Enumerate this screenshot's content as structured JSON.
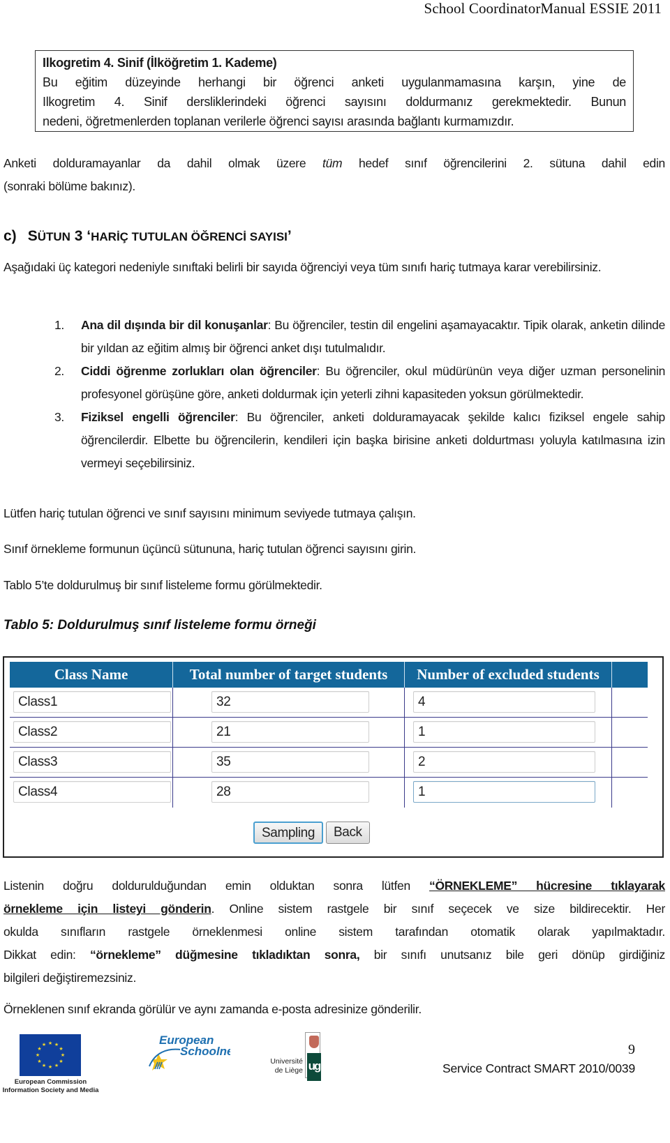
{
  "header": {
    "title": "School CoordinatorManual ESSIE 2011"
  },
  "note_box": {
    "title": "Ilkogretim 4. Sinif (İlköğretim 1. Kademe)",
    "lines": [
      "Bu eğitim düzeyinde herhangi bir öğrenci anketi uygulanmamasına karşın, yine de",
      "Ilkogretim 4. Sinif dersliklerindeki öğrenci sayısını doldurmanız gerekmektedir. Bunun",
      "nedeni, öğretmenlerden toplanan verilerle öğrenci sayısı arasında bağlantı kurmamızdır."
    ]
  },
  "paragraph_anketi": {
    "before_italic": "Anketi dolduramayanlar da dahil olmak üzere ",
    "italic": "tüm",
    "after_italic": " hedef sınıf öğrencilerini 2. sütuna dahil edin",
    "line2": "(sonraki bölüme bakınız)."
  },
  "section": {
    "letter": "c)",
    "s_big": "S",
    "s_rest": "ÜTUN",
    "num": " 3 ",
    "quote_open": "‘",
    "title_rest": "HARİÇ TUTULAN ÖĞRENCİ SAYISI",
    "quote_close": "’"
  },
  "paragraph_asagi": "Aşağıdaki üç kategori nedeniyle sınıftaki belirli bir sayıda öğrenciyi veya tüm sınıfı hariç tutmaya karar verebilirsiniz.",
  "categories": [
    {
      "num": "1.",
      "bold": "Ana dil dışında bir dil konuşanlar",
      "text": ": Bu öğrenciler, testin dil engelini aşamayacaktır. Tipik olarak, anketin dilinde bir yıldan az eğitim almış bir öğrenci anket dışı tutulmalıdır."
    },
    {
      "num": "2.",
      "bold": "Ciddi öğrenme zorlukları olan öğrenciler",
      "text": ": Bu öğrenciler, okul müdürünün veya diğer uzman personelinin profesyonel görüşüne göre, anketi doldurmak için yeterli zihni kapasiteden yoksun görülmektedir."
    },
    {
      "num": "3.",
      "bold": "Fiziksel engelli öğrenciler",
      "text": ": Bu öğrenciler, anketi dolduramayacak şekilde kalıcı fiziksel engele sahip öğrencilerdir. Elbette bu öğrencilerin, kendileri için başka birisine anketi doldurtması yoluyla katılmasına izin vermeyi seçebilirsiniz."
    }
  ],
  "paragraph_lutfen": "Lütfen hariç tutulan öğrenci ve sınıf sayısını minimum seviyede tutmaya çalışın.",
  "paragraph_sinif": "Sınıf örnekleme formunun üçüncü sütununa, hariç tutulan öğrenci sayısını girin.",
  "paragraph_tablo": "Tablo 5’te doldurulmuş bir sınıf listeleme formu görülmektedir.",
  "table_caption": "Tablo 5: Doldurulmuş sınıf listeleme formu örneği",
  "form": {
    "header_color": "#14679b",
    "columns": [
      "Class Name",
      "Total number of target students",
      "Number of excluded students"
    ],
    "rows": [
      {
        "class_name": "Class1",
        "total": "32",
        "excluded": "4"
      },
      {
        "class_name": "Class2",
        "total": "21",
        "excluded": "1"
      },
      {
        "class_name": "Class3",
        "total": "35",
        "excluded": "2"
      },
      {
        "class_name": "Class4",
        "total": "28",
        "excluded": "1"
      }
    ],
    "buttons": {
      "sampling": "Sampling",
      "back": "Back"
    }
  },
  "paragraph_listenin": {
    "l1_plain": "Listenin doğru doldurulduğundan emin olduktan sonra lütfen ",
    "l1_ul": "“ÖRNEKLEME” hücresine tıklayarak",
    "l2_ul": "örnekleme için listeyi gönderin",
    "l2_plain": ". Online sistem rastgele bir sınıf seçecek ve size bildirecektir. Her",
    "l3": "okulda sınıfların rastgele örneklenmesi online sistem tarafından otomatik olarak yapılmaktadır.",
    "l4_plain": "Dikkat edin: ",
    "l4_bold": "“örnekleme” düğmesine tıkladıktan sonra,",
    "l4_rest": " bir sınıfı unutsanız bile geri dönüp girdiğiniz",
    "l5": "bilgileri değiştiremezsiniz."
  },
  "paragraph_orneklenen": "Örneklenen sınıf ekranda görülür ve aynı zamanda e-posta adresinize gönderilir.",
  "footer": {
    "ec_caption_1": "European Commission",
    "ec_caption_2": "Information Society and Media",
    "esn_line1": "European",
    "esn_line2": "Schoolnet",
    "ulg_line1": "Université",
    "ulg_line2": "de Liège",
    "ulg_mark": "ug",
    "page_number": "9",
    "contract": "Service Contract SMART 2010/0039"
  }
}
